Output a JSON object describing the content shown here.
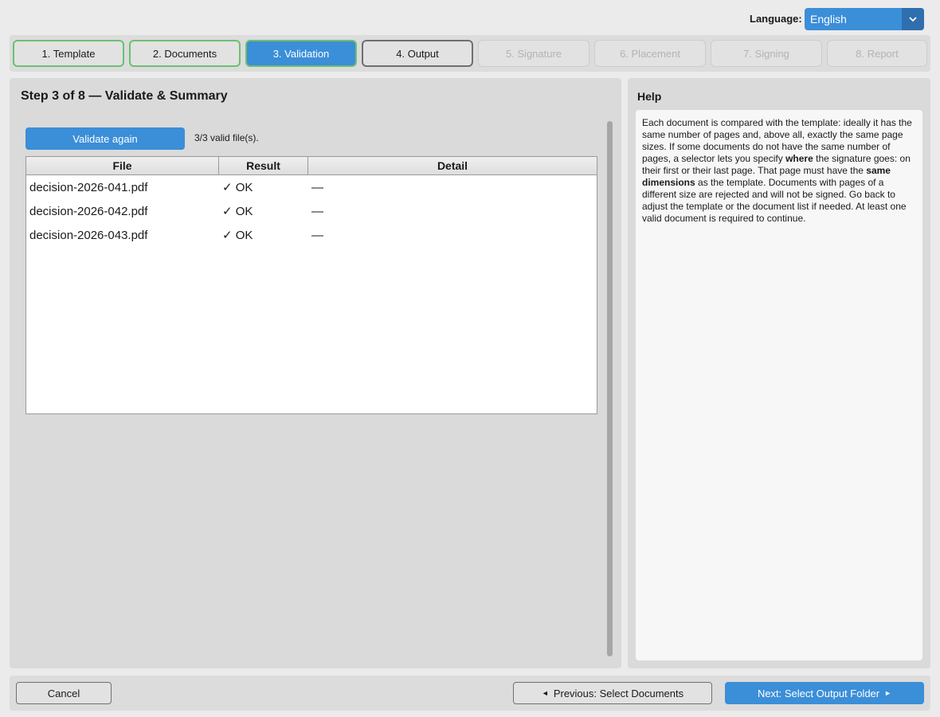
{
  "language": {
    "label": "Language:",
    "value": "English"
  },
  "steps": [
    {
      "label": "1. Template",
      "state": "done"
    },
    {
      "label": "2. Documents",
      "state": "done"
    },
    {
      "label": "3. Validation",
      "state": "active"
    },
    {
      "label": "4. Output",
      "state": "next"
    },
    {
      "label": "5. Signature",
      "state": "disabled"
    },
    {
      "label": "6. Placement",
      "state": "disabled"
    },
    {
      "label": "7. Signing",
      "state": "disabled"
    },
    {
      "label": "8. Report",
      "state": "disabled"
    }
  ],
  "main": {
    "title": "Step 3 of 8 — Validate & Summary",
    "validate_button": "Validate again",
    "status": "3/3 valid file(s).",
    "table": {
      "headers": [
        "File",
        "Result",
        "Detail"
      ],
      "rows": [
        [
          "decision-2026-041.pdf",
          "✓ OK",
          "—"
        ],
        [
          "decision-2026-042.pdf",
          "✓ OK",
          "—"
        ],
        [
          "decision-2026-043.pdf",
          "✓ OK",
          "—"
        ]
      ]
    }
  },
  "help": {
    "title": "Help",
    "text_1": "Each document is compared with the template: ideally it has the same number of pages and, above all, exactly the same page sizes. If some documents do not have the same number of pages, a selector lets you specify ",
    "bold_1": "where",
    "text_2": " the signature goes: on their first or their last page. That page must have the ",
    "bold_2": "same dimensions",
    "text_3": " as the template. Documents with pages of a different size are rejected and will not be signed. Go back to adjust the template or the document list if needed. At least one valid document is required to continue."
  },
  "footer": {
    "cancel": "Cancel",
    "previous": "Previous: Select Documents",
    "next": "Next: Select Output Folder"
  },
  "colors": {
    "accent": "#3b8ed8",
    "done_border": "#6cc070"
  }
}
